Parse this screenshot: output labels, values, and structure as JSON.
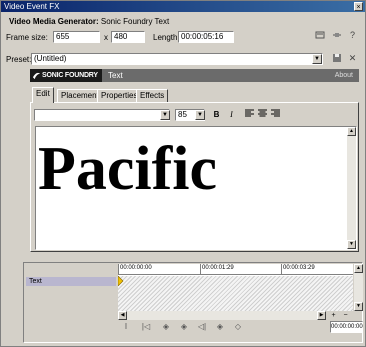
{
  "window": {
    "title": "Video Event FX",
    "close_glyph": "×"
  },
  "generator": {
    "label": "Video Media Generator:",
    "name": "Sonic Foundry Text"
  },
  "frame": {
    "label": "Frame size:",
    "width": "655",
    "times": "x",
    "height": "480"
  },
  "length": {
    "label": "Length:",
    "value": "00:00:05:16"
  },
  "toolbar_icons": [
    "properties-icon",
    "plugin-chain-icon",
    "help-icon"
  ],
  "preset": {
    "label": "Preset:",
    "value": "(Untitled)"
  },
  "brand": {
    "logo": "SONIC FOUNDRY",
    "plugin": "Text",
    "about": "About"
  },
  "tabs": [
    "Edit",
    "Placement",
    "Properties",
    "Effects"
  ],
  "format": {
    "font_value": "",
    "size_value": "85",
    "bold": "B",
    "italic": "I"
  },
  "editor": {
    "text": "Pacific"
  },
  "timeline": {
    "track": "Text",
    "ticks": [
      "00:00:00:00",
      "00:00:01:29",
      "00:00:03:29"
    ],
    "time": "00:00:00:00"
  }
}
